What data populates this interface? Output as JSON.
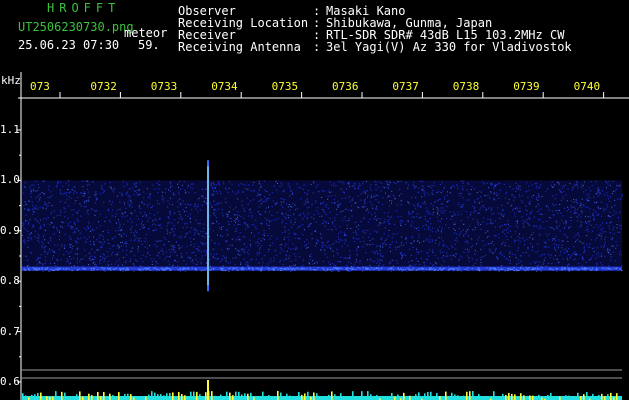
{
  "brand": "HROFFT",
  "file_name": "UT2506230730.png",
  "detector_label": "meteor",
  "date_time": "25.06.23 07:30",
  "count": "59.",
  "info": [
    {
      "label": "Observer",
      "sep": ":",
      "value": "Masaki Kano"
    },
    {
      "label": "Receiving Location",
      "sep": ":",
      "value": "Shibukawa, Gunma, Japan"
    },
    {
      "label": "Receiver",
      "sep": ":",
      "value": "RTL-SDR SDR# 43dB L15 103.2MHz CW"
    },
    {
      "label": "Receiving Antenna",
      "sep": ":",
      "value": "3el Yagi(V) Az 330 for Vladivostok"
    }
  ],
  "y_unit": "kHz",
  "y_ticks": [
    "1.1",
    "1.0",
    "0.9",
    "0.8",
    "0.7",
    "0.6"
  ],
  "x_ticks": [
    "073",
    "0732",
    "0733",
    "0734",
    "0735",
    "0736",
    "0737",
    "0738",
    "0739",
    "0740"
  ],
  "colors": {
    "background": "#000000",
    "header_text": "#3cc23c",
    "info_text": "#ffffff",
    "x_tick_text": "#ffff33",
    "noise_band": "#1f2fd0",
    "carrier": "#4a7cff",
    "meteor": "#9fffd0",
    "bottom_bars_cyan": "#22e0e0",
    "bottom_bars_yellow": "#ffff33"
  },
  "chart_data": {
    "type": "heatmap",
    "y_unit": "kHz",
    "ylim": [
      0.6,
      1.1
    ],
    "x_ticks": [
      "073",
      "0732",
      "0733",
      "0734",
      "0735",
      "0736",
      "0737",
      "0738",
      "0739",
      "0740"
    ],
    "noise_band_khz": [
      0.82,
      1.0
    ],
    "carrier_khz": 0.825,
    "meteor_event": {
      "label": "meteor",
      "freq_range_khz": [
        0.78,
        1.04
      ]
    }
  }
}
